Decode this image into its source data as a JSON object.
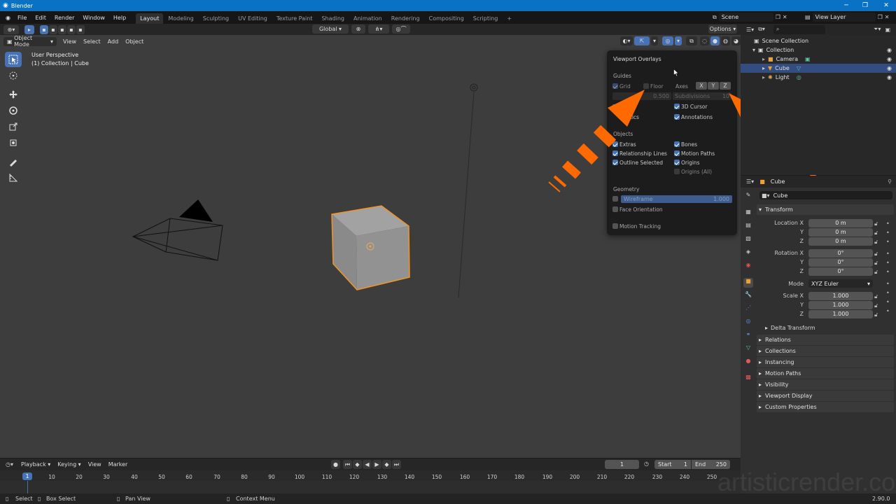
{
  "window": {
    "title": "Blender"
  },
  "menubar": {
    "items": [
      "File",
      "Edit",
      "Render",
      "Window",
      "Help"
    ]
  },
  "workspaces": {
    "tabs": [
      "Layout",
      "Modeling",
      "Sculpting",
      "UV Editing",
      "Texture Paint",
      "Shading",
      "Animation",
      "Rendering",
      "Compositing",
      "Scripting"
    ],
    "active": "Layout"
  },
  "scene": {
    "name": "Scene",
    "view_layer": "View Layer"
  },
  "viewport": {
    "transform_orientation": "Global",
    "options_label": "Options",
    "mode": "Object Mode",
    "menus": [
      "View",
      "Select",
      "Add",
      "Object"
    ],
    "info_line1": "User Perspective",
    "info_line2": "(1) Collection | Cube"
  },
  "overlays": {
    "title": "Viewport Overlays",
    "guides_label": "Guides",
    "grid": "Grid",
    "floor": "Floor",
    "axes": "Axes",
    "axis_x": "X",
    "axis_y": "Y",
    "axis_z": "Z",
    "scale_value": "0.500",
    "subdivisions_label": "Subdivisions",
    "subdivisions_value": "10",
    "statistics_partial": "stics",
    "cursor_3d": "3D Cursor",
    "annotations": "Annotations",
    "objects_label": "Objects",
    "extras": "Extras",
    "bones": "Bones",
    "relationship_lines": "Relationship Lines",
    "motion_paths": "Motion Paths",
    "outline_selected": "Outline Selected",
    "origins": "Origins",
    "origins_all": "Origins (All)",
    "geometry_label": "Geometry",
    "wireframe": "Wireframe",
    "wireframe_value": "1.000",
    "face_orientation": "Face Orientation",
    "motion_tracking": "Motion Tracking"
  },
  "outliner": {
    "rows": [
      {
        "label": "Scene Collection"
      },
      {
        "label": "Collection"
      },
      {
        "label": "Camera"
      },
      {
        "label": "Cube"
      },
      {
        "label": "Light"
      }
    ]
  },
  "properties": {
    "object_name": "Cube",
    "object_name_field": "Cube",
    "transform_label": "Transform",
    "location_label": "Location X",
    "rotation_label": "Rotation X",
    "scale_label": "Scale X",
    "y": "Y",
    "z": "Z",
    "location": [
      "0 m",
      "0 m",
      "0 m"
    ],
    "rotation": [
      "0°",
      "0°",
      "0°"
    ],
    "mode_label": "Mode",
    "mode_value": "XYZ Euler",
    "scale": [
      "1.000",
      "1.000",
      "1.000"
    ],
    "delta_transform": "Delta Transform",
    "panels": [
      "Relations",
      "Collections",
      "Instancing",
      "Motion Paths",
      "Visibility",
      "Viewport Display",
      "Custom Properties"
    ]
  },
  "timeline": {
    "menus": [
      "Playback",
      "Keying",
      "View",
      "Marker"
    ],
    "current_frame": "1",
    "start_label": "Start",
    "start": "1",
    "end_label": "End",
    "end": "250",
    "current_marker": "1",
    "ticks": [
      "10",
      "20",
      "30",
      "40",
      "50",
      "60",
      "70",
      "80",
      "90",
      "100",
      "110",
      "120",
      "130",
      "140",
      "150",
      "160",
      "170",
      "180",
      "190",
      "200",
      "210",
      "220",
      "230",
      "240",
      "250"
    ]
  },
  "statusbar": {
    "select": "Select",
    "box_select": "Box Select",
    "pan_view": "Pan View",
    "context_menu": "Context Menu",
    "version": "2.90.0"
  },
  "watermark": "artisticrender.com",
  "colors": {
    "accent": "#4772b3",
    "title_bar": "#0a72c5",
    "arrow": "#ff6a00",
    "selection_outline": "#f0942a"
  }
}
